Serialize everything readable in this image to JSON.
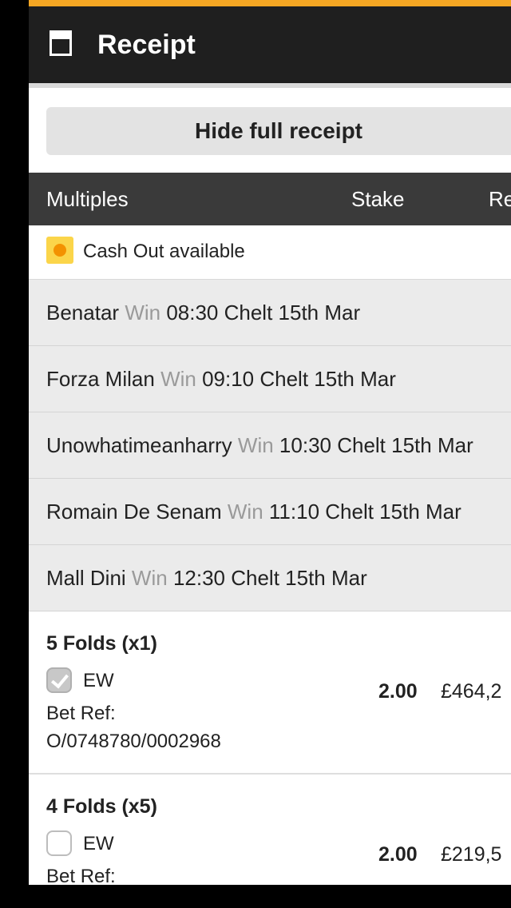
{
  "header": {
    "title": "Receipt",
    "icon": "receipt-icon"
  },
  "hide_button": {
    "label": "Hide full receipt"
  },
  "columns": {
    "multiples": "Multiples",
    "stake": "Stake",
    "returns": "Re"
  },
  "cash_out": {
    "label": "Cash Out available",
    "badge_color": "#fbd54a",
    "dot_color": "#f39200"
  },
  "selections": [
    {
      "name": "Benatar",
      "market": "Win",
      "details": "08:30 Chelt 15th Mar"
    },
    {
      "name": "Forza Milan",
      "market": "Win",
      "details": "09:10 Chelt 15th Mar"
    },
    {
      "name": "Unowhatimeanharry",
      "market": "Win",
      "details": "10:30 Chelt 15th Mar"
    },
    {
      "name": "Romain De Senam",
      "market": "Win",
      "details": "11:10 Chelt 15th Mar"
    },
    {
      "name": "Mall Dini",
      "market": "Win",
      "details": "12:30 Chelt 15th Mar"
    }
  ],
  "bets": [
    {
      "title": "5 Folds (x1)",
      "ew_label": "EW",
      "ew_checked": true,
      "bet_ref_label": "Bet Ref:",
      "bet_ref": "O/0748780/0002968",
      "stake": "2.00",
      "returns": "£464,2"
    },
    {
      "title": "4 Folds (x5)",
      "ew_label": "EW",
      "ew_checked": false,
      "bet_ref_label": "Bet Ref:",
      "bet_ref": "",
      "stake": "2.00",
      "returns": "£219,5"
    }
  ],
  "colors": {
    "accent": "#f5a623",
    "header_bg": "#1f1f1f",
    "column_header_bg": "#3a3a3a"
  }
}
